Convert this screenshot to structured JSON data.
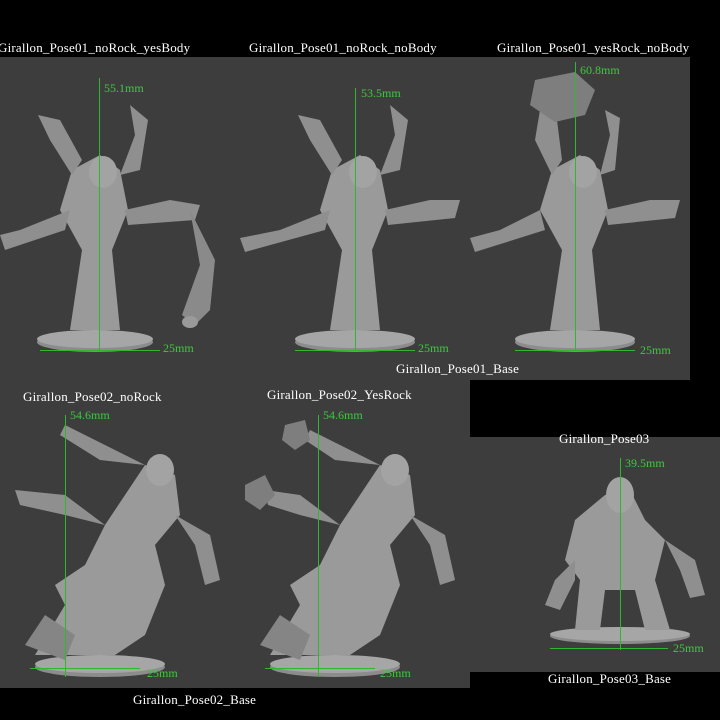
{
  "labels": {
    "p1a": "Girallon_Pose01_noRock_yesBody",
    "p1b": "Girallon_Pose01_noRock_noBody",
    "p1c": "Girallon_Pose01_yesRock_noBody",
    "p1base": "Girallon_Pose01_Base",
    "p2a": "Girallon_Pose02_noRock",
    "p2b": "Girallon_Pose02_YesRock",
    "p2base": "Girallon_Pose02_Base",
    "p3": "Girallon_Pose03",
    "p3base": "Girallon_Pose03_Base"
  },
  "dimensions": {
    "h1a": "55.1mm",
    "h1b": "53.5mm",
    "h1c": "60.8mm",
    "h2a": "54.6mm",
    "h2b": "54.6mm",
    "h3": "39.5mm",
    "base": "25mm"
  },
  "colors": {
    "background": "#000000",
    "panel": "#3d3d3d",
    "model": "#9a9a9a",
    "measure": "#2fb82f"
  }
}
